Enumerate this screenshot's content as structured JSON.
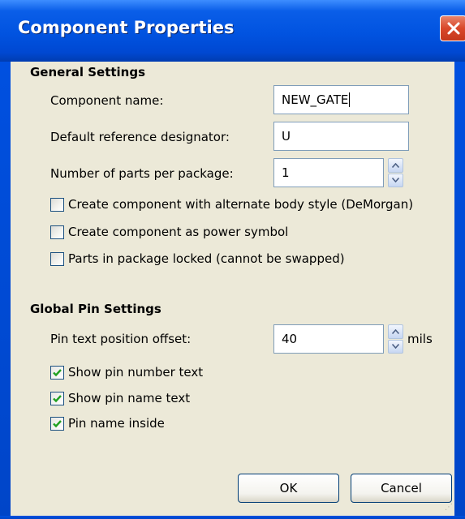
{
  "window": {
    "title": "Component Properties"
  },
  "general": {
    "heading": "General Settings",
    "component_name_label": "Component name:",
    "component_name_value": "NEW_GATE",
    "ref_designator_label": "Default reference designator:",
    "ref_designator_value": "U",
    "parts_per_package_label": "Number of parts per package:",
    "parts_per_package_value": "1",
    "demorgan_label": "Create component with alternate body style (DeMorgan)",
    "demorgan_checked": false,
    "power_symbol_label": "Create component as power symbol",
    "power_symbol_checked": false,
    "parts_locked_label": "Parts in package locked (cannot be swapped)",
    "parts_locked_checked": false
  },
  "pins": {
    "heading": "Global Pin Settings",
    "offset_label": "Pin text position offset:",
    "offset_value": "40",
    "offset_unit": "mils",
    "show_number_label": "Show pin number text",
    "show_number_checked": true,
    "show_name_label": "Show pin name text",
    "show_name_checked": true,
    "name_inside_label": "Pin name inside",
    "name_inside_checked": true
  },
  "buttons": {
    "ok": "OK",
    "cancel": "Cancel"
  },
  "colors": {
    "titlebar": "#0153e0",
    "dialog_bg": "#ece9d8",
    "close_button": "#d9482a",
    "check_mark": "#21a121"
  },
  "icons": {
    "close": "close-icon",
    "spin_up": "spin-up-icon",
    "spin_down": "spin-down-icon",
    "check": "checkmark-icon"
  }
}
